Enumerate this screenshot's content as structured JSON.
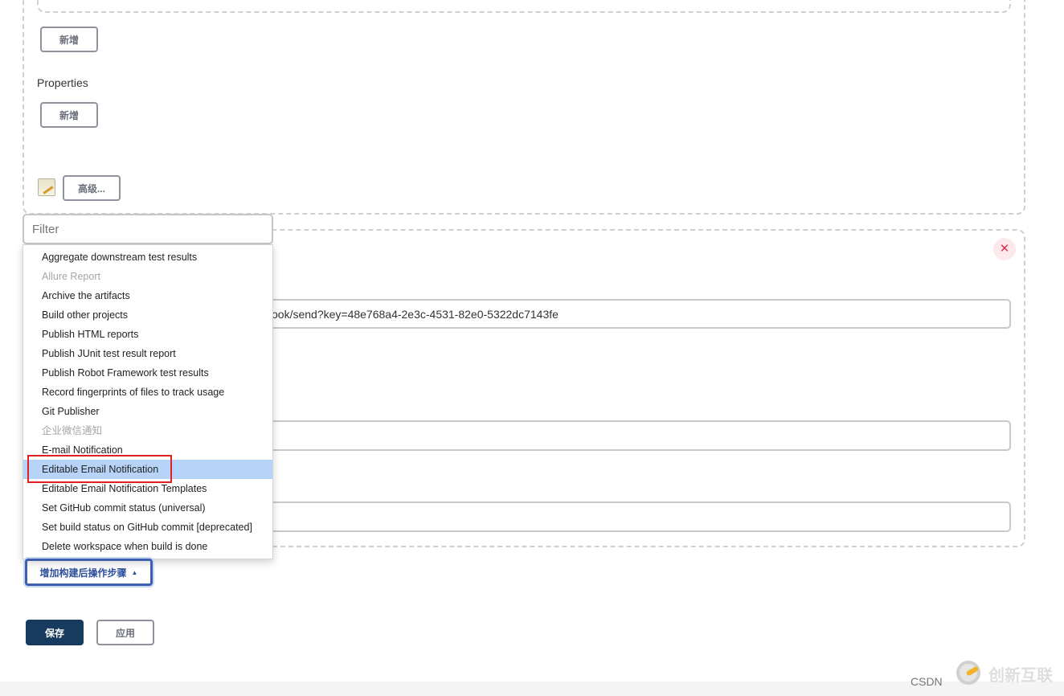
{
  "section1": {
    "add_button_1": "新增",
    "properties_label": "Properties",
    "add_button_2": "新增",
    "advanced_button": "高级..."
  },
  "section2": {
    "webhook_value": "ook/send?key=48e768a4-2e3c-4531-82e0-5322dc7143fe",
    "field2_value": "",
    "field3_value": "",
    "delete_icon": "close-icon"
  },
  "dropdown": {
    "filter_placeholder": "Filter",
    "items": [
      {
        "label": "Aggregate downstream test results",
        "disabled": false
      },
      {
        "label": "Allure Report",
        "disabled": true
      },
      {
        "label": "Archive the artifacts",
        "disabled": false
      },
      {
        "label": "Build other projects",
        "disabled": false
      },
      {
        "label": "Publish HTML reports",
        "disabled": false
      },
      {
        "label": "Publish JUnit test result report",
        "disabled": false
      },
      {
        "label": "Publish Robot Framework test results",
        "disabled": false
      },
      {
        "label": "Record fingerprints of files to track usage",
        "disabled": false
      },
      {
        "label": "Git Publisher",
        "disabled": false
      },
      {
        "label": "企业微信通知",
        "disabled": true
      },
      {
        "label": "E-mail Notification",
        "disabled": false
      },
      {
        "label": "Editable Email Notification",
        "disabled": false,
        "selected": true
      },
      {
        "label": "Editable Email Notification Templates",
        "disabled": false
      },
      {
        "label": "Set GitHub commit status (universal)",
        "disabled": false
      },
      {
        "label": "Set build status on GitHub commit [deprecated]",
        "disabled": false
      },
      {
        "label": "Delete workspace when build is done",
        "disabled": false
      }
    ]
  },
  "add_post_build_button": "增加构建后操作步骤",
  "save_button": "保存",
  "apply_button": "应用",
  "watermark": {
    "csdn": "CSDN",
    "brand": "创新互联"
  },
  "colors": {
    "highlight": "#b8d3f8",
    "save_bg": "#173b5f",
    "annotation": "#e02020"
  }
}
